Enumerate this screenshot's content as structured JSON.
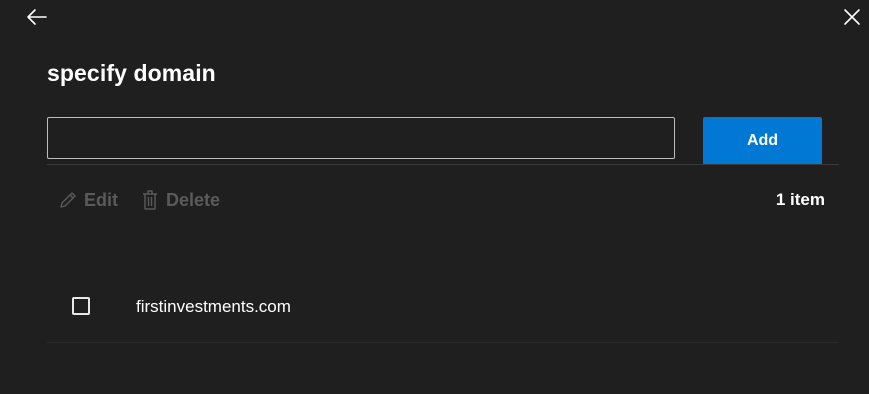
{
  "header": {
    "back_icon": "back-arrow-icon",
    "close_icon": "close-icon"
  },
  "title": "specify domain",
  "domain_input": {
    "value": "",
    "placeholder": ""
  },
  "add_button": {
    "label": "Add",
    "color": "#0078d4"
  },
  "toolbar": {
    "edit_label": "Edit",
    "edit_icon": "pencil-icon",
    "delete_label": "Delete",
    "delete_icon": "trash-icon"
  },
  "item_count": "1 item",
  "list": {
    "items": [
      {
        "label": "firstinvestments.com",
        "checked": false
      }
    ]
  }
}
